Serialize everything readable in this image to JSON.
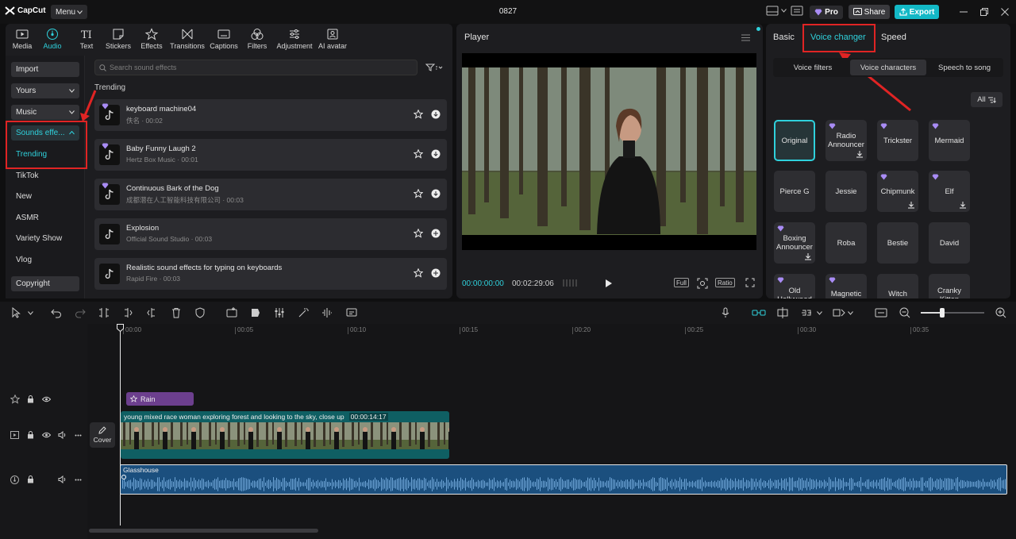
{
  "app": {
    "logo_text": "CapCut",
    "menu_label": "Menu",
    "project_title": "0827",
    "pro_label": "Pro",
    "share_label": "Share",
    "export_label": "Export"
  },
  "toolbar": {
    "tabs": [
      {
        "label": "Media",
        "icon": "media-icon"
      },
      {
        "label": "Audio",
        "icon": "audio-icon",
        "active": true
      },
      {
        "label": "Text",
        "icon": "text-icon"
      },
      {
        "label": "Stickers",
        "icon": "stickers-icon"
      },
      {
        "label": "Effects",
        "icon": "effects-icon"
      },
      {
        "label": "Transitions",
        "icon": "transitions-icon"
      },
      {
        "label": "Captions",
        "icon": "captions-icon"
      },
      {
        "label": "Filters",
        "icon": "filters-icon"
      },
      {
        "label": "Adjustment",
        "icon": "adjustment-icon"
      },
      {
        "label": "AI avatar",
        "icon": "ai-avatar-icon"
      }
    ]
  },
  "audio_sidebar": {
    "import": "Import",
    "yours": "Yours",
    "music": "Music",
    "sounds_effects": "Sounds effe...",
    "trending": "Trending",
    "tiktok": "TikTok",
    "new": "New",
    "asmr": "ASMR",
    "variety_show": "Variety Show",
    "vlog": "Vlog",
    "copyright": "Copyright"
  },
  "sound_list": {
    "search_placeholder": "Search sound effects",
    "section_title": "Trending",
    "items": [
      {
        "title": "keyboard machine04",
        "subtitle": "佚名 · 00:02",
        "pro": true,
        "downloaded": false
      },
      {
        "title": "Baby Funny Laugh 2",
        "subtitle": "Hertz Box Music · 00:01",
        "pro": true,
        "downloaded": false
      },
      {
        "title": "Continuous Bark of the Dog",
        "subtitle": "成都潜在人工智能科技有限公司 · 00:03",
        "pro": true,
        "downloaded": false
      },
      {
        "title": "Explosion",
        "subtitle": "Official Sound Studio · 00:03",
        "pro": false,
        "downloaded": true
      },
      {
        "title": "Realistic sound effects for typing on keyboards",
        "subtitle": "Rapid Fire · 00:03",
        "pro": false,
        "downloaded": true
      }
    ]
  },
  "player": {
    "title": "Player",
    "current_time": "00:00:00:00",
    "total_time": "00:02:29:06",
    "full_label": "Full",
    "ratio_label": "Ratio"
  },
  "right_panel": {
    "tabs": {
      "basic": "Basic",
      "voice_changer": "Voice changer",
      "speed": "Speed"
    },
    "subtabs": {
      "voice_filters": "Voice filters",
      "voice_characters": "Voice characters",
      "speech_to_song": "Speech to song"
    },
    "filter_label": "All",
    "voices": [
      {
        "name": "Original",
        "pro": false,
        "download": false,
        "selected": true
      },
      {
        "name": "Radio Announcer",
        "pro": true,
        "download": true
      },
      {
        "name": "Trickster",
        "pro": true,
        "download": false
      },
      {
        "name": "Mermaid",
        "pro": true,
        "download": false
      },
      {
        "name": "Pierce G",
        "pro": false,
        "download": false
      },
      {
        "name": "Jessie",
        "pro": false,
        "download": false
      },
      {
        "name": "Chipmunk",
        "pro": true,
        "download": true
      },
      {
        "name": "Elf",
        "pro": true,
        "download": true
      },
      {
        "name": "Boxing Announcer",
        "pro": true,
        "download": true
      },
      {
        "name": "Roba",
        "pro": false,
        "download": false
      },
      {
        "name": "Bestie",
        "pro": false,
        "download": false
      },
      {
        "name": "David",
        "pro": false,
        "download": false
      },
      {
        "name": "Old Hollywood",
        "pro": true,
        "download": false
      },
      {
        "name": "Magnetic",
        "pro": true,
        "download": false
      },
      {
        "name": "Witch",
        "pro": false,
        "download": false
      },
      {
        "name": "Cranky Kitten",
        "pro": false,
        "download": false
      }
    ]
  },
  "timeline": {
    "ruler": [
      "00:00",
      "00:05",
      "00:10",
      "00:15",
      "00:20",
      "00:25",
      "00:30",
      "00:35"
    ],
    "effect_clip": "Rain",
    "video_clip_title": "young mixed race woman exploring forest and looking to the sky, close up",
    "video_clip_duration": "00:00:14:17",
    "cover_label": "Cover",
    "audio_clip": "Glasshouse"
  },
  "colors": {
    "accent": "#2fd1dc",
    "highlight_red": "#e02424",
    "video_track": "#0f5f63",
    "audio_track": "#1b4f7e",
    "effect_clip": "#6c3f8e"
  }
}
